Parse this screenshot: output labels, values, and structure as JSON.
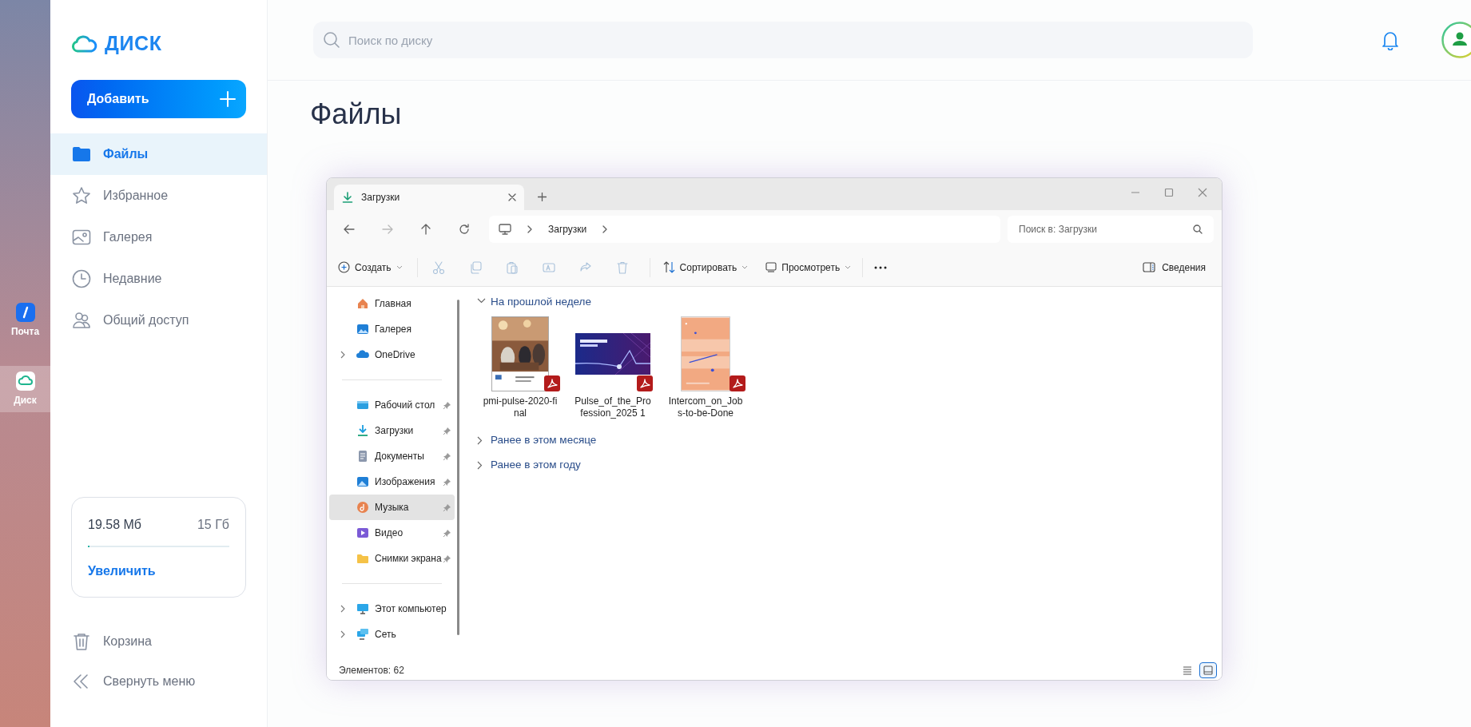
{
  "rail": [
    {
      "label": "Почта",
      "selected": false
    },
    {
      "label": "Диск",
      "selected": true
    }
  ],
  "logo": {
    "text": "ДИСК"
  },
  "add_button": {
    "label": "Добавить"
  },
  "nav": [
    {
      "label": "Файлы",
      "selected": true
    },
    {
      "label": "Избранное",
      "selected": false
    },
    {
      "label": "Галерея",
      "selected": false
    },
    {
      "label": "Недавние",
      "selected": false
    },
    {
      "label": "Общий доступ",
      "selected": false
    }
  ],
  "storage": {
    "used": "19.58 Мб",
    "total": "15 Гб",
    "level": 0.0013,
    "action": "Увеличить"
  },
  "bottom_nav": [
    {
      "label": "Корзина"
    },
    {
      "label": "Свернуть меню"
    }
  ],
  "search": {
    "placeholder": "Поиск по диску"
  },
  "page_title": "Файлы",
  "explorer": {
    "tab": {
      "label": "Загрузки"
    },
    "forward": {
      "disabled": true
    },
    "breadcrumb": [
      "Загрузки"
    ],
    "search": {
      "placeholder": "Поиск в: Загрузки"
    },
    "toolbar": {
      "create": "Создать",
      "sort": "Сортировать",
      "view": "Просмотреть",
      "details": "Сведения"
    },
    "actions": [
      {
        "disabled": true
      },
      {
        "disabled": true
      },
      {
        "disabled": true
      },
      {
        "disabled": true
      },
      {
        "disabled": true
      },
      {
        "disabled": true
      }
    ],
    "nav_sections": [
      {
        "items": [
          {
            "label": "Главная",
            "expandable": false,
            "pinned": false,
            "selected": false
          },
          {
            "label": "Галерея",
            "expandable": false,
            "pinned": false,
            "selected": false
          },
          {
            "label": "OneDrive",
            "expandable": true,
            "pinned": false,
            "selected": false
          }
        ]
      },
      {
        "items": [
          {
            "label": "Рабочий стол",
            "expandable": false,
            "pinned": true,
            "selected": false
          },
          {
            "label": "Загрузки",
            "expandable": false,
            "pinned": true,
            "selected": false
          },
          {
            "label": "Документы",
            "expandable": false,
            "pinned": true,
            "selected": false
          },
          {
            "label": "Изображения",
            "expandable": false,
            "pinned": true,
            "selected": false
          },
          {
            "label": "Музыка",
            "expandable": false,
            "pinned": true,
            "selected": true
          },
          {
            "label": "Видео",
            "expandable": false,
            "pinned": true,
            "selected": false
          },
          {
            "label": "Снимки экрана",
            "expandable": false,
            "pinned": true,
            "selected": false
          }
        ]
      },
      {
        "items": [
          {
            "label": "Этот компьютер",
            "expandable": true,
            "pinned": false,
            "selected": false
          },
          {
            "label": "Сеть",
            "expandable": true,
            "pinned": false,
            "selected": false
          }
        ]
      }
    ],
    "groups": [
      {
        "label": "На прошлой неделе",
        "expanded": true,
        "files": [
          {
            "name": "pmi-pulse-2020-final"
          },
          {
            "name": "Pulse_of_the_Profession_2025 1"
          },
          {
            "name": "Intercom_on_Jobs-to-be-Done"
          }
        ]
      },
      {
        "label": "Ранее в этом месяце",
        "expanded": false
      },
      {
        "label": "Ранее в этом году",
        "expanded": false
      }
    ],
    "status": "Элементов: 62",
    "views": [
      {
        "selected": false
      },
      {
        "selected": true
      }
    ]
  }
}
